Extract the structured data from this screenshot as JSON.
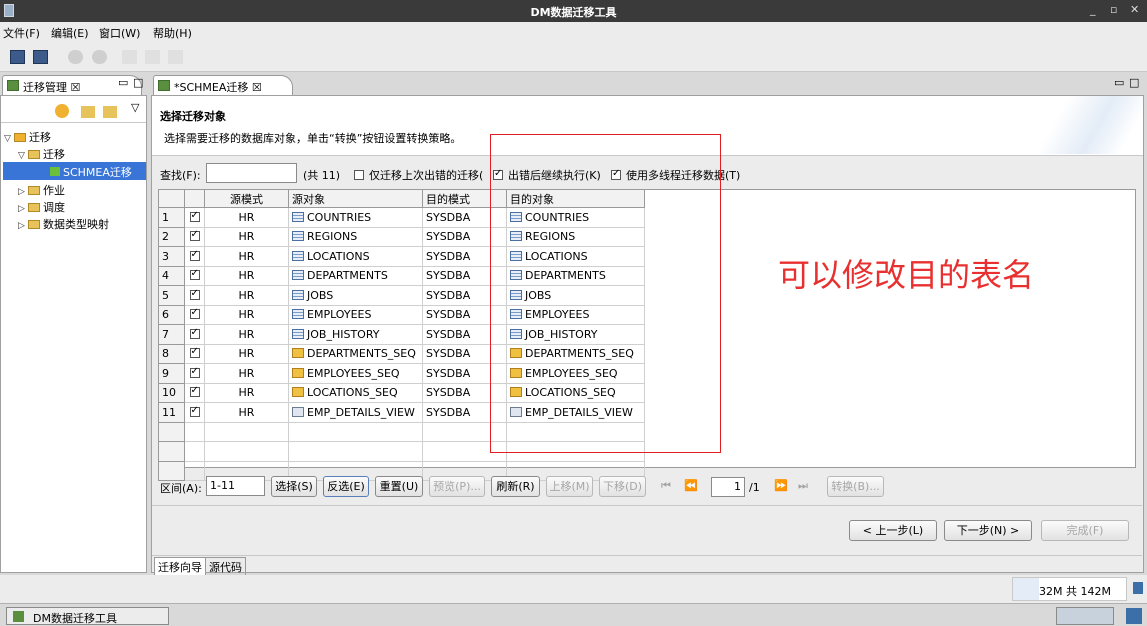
{
  "window": {
    "title": "DM数据迁移工具",
    "controls": [
      "_",
      "▫",
      "✕"
    ]
  },
  "menu": [
    "文件(F)",
    "编辑(E)",
    "窗口(W)",
    "帮助(H)"
  ],
  "left_panel": {
    "tab": "迁移管理 ☒",
    "tree": {
      "root": "迁移",
      "project": "迁移",
      "selected": "SCHMEA迁移",
      "others": [
        "作业",
        "调度",
        "数据类型映射"
      ]
    }
  },
  "editor": {
    "tab": "*SCHMEA迁移 ☒",
    "title": "选择迁移对象",
    "desc": "选择需要迁移的数据库对象，单击“转换”按钮设置转换策略。",
    "find_label": "查找(F):",
    "find_value": "",
    "count": "(共 11)",
    "opt_last_failed": "仅迁移上次出错的迁移(",
    "opt_continue": "出错后继续执行(K)",
    "opt_multithread": "使用多线程迁移数据(T)",
    "columns": [
      "",
      "",
      "源模式",
      "源对象",
      "目的模式",
      "目的对象"
    ],
    "rows": [
      {
        "n": "1",
        "schema": "HR",
        "src": "COUNTRIES",
        "dst_schema": "SYSDBA",
        "dst": "COUNTRIES",
        "kind": "table"
      },
      {
        "n": "2",
        "schema": "HR",
        "src": "REGIONS",
        "dst_schema": "SYSDBA",
        "dst": "REGIONS",
        "kind": "table"
      },
      {
        "n": "3",
        "schema": "HR",
        "src": "LOCATIONS",
        "dst_schema": "SYSDBA",
        "dst": "LOCATIONS",
        "kind": "table"
      },
      {
        "n": "4",
        "schema": "HR",
        "src": "DEPARTMENTS",
        "dst_schema": "SYSDBA",
        "dst": "DEPARTMENTS",
        "kind": "table"
      },
      {
        "n": "5",
        "schema": "HR",
        "src": "JOBS",
        "dst_schema": "SYSDBA",
        "dst": "JOBS",
        "kind": "table"
      },
      {
        "n": "6",
        "schema": "HR",
        "src": "EMPLOYEES",
        "dst_schema": "SYSDBA",
        "dst": "EMPLOYEES",
        "kind": "table"
      },
      {
        "n": "7",
        "schema": "HR",
        "src": "JOB_HISTORY",
        "dst_schema": "SYSDBA",
        "dst": "JOB_HISTORY",
        "kind": "table"
      },
      {
        "n": "8",
        "schema": "HR",
        "src": "DEPARTMENTS_SEQ",
        "dst_schema": "SYSDBA",
        "dst": "DEPARTMENTS_SEQ",
        "kind": "seq"
      },
      {
        "n": "9",
        "schema": "HR",
        "src": "EMPLOYEES_SEQ",
        "dst_schema": "SYSDBA",
        "dst": "EMPLOYEES_SEQ",
        "kind": "seq"
      },
      {
        "n": "10",
        "schema": "HR",
        "src": "LOCATIONS_SEQ",
        "dst_schema": "SYSDBA",
        "dst": "LOCATIONS_SEQ",
        "kind": "seq"
      },
      {
        "n": "11",
        "schema": "HR",
        "src": "EMP_DETAILS_VIEW",
        "dst_schema": "SYSDBA",
        "dst": "EMP_DETAILS_VIEW",
        "kind": "view"
      }
    ],
    "range_label": "区间(A):",
    "range_value": "1-11",
    "buttons": {
      "select": "选择(S)",
      "invert": "反选(E)",
      "reset": "重置(U)",
      "preview": "预览(P)...",
      "refresh": "刷新(R)",
      "up": "上移(M)",
      "down": "下移(D)",
      "convert": "转换(B)..."
    },
    "page_value": "1",
    "page_total": "/1",
    "nav": {
      "prev": "< 上一步(L)",
      "next": "下一步(N) >",
      "finish": "完成(F)"
    },
    "bottom_tabs": [
      "迁移向导",
      "源代码"
    ]
  },
  "annotation": "可以修改目的表名",
  "status": {
    "memory": "32M 共 142M"
  },
  "taskbar": {
    "item": "DM数据迁移工具"
  }
}
